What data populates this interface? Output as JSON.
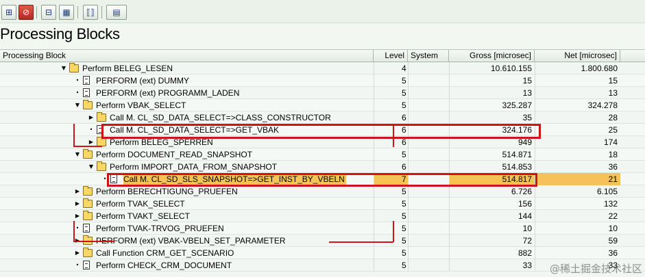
{
  "toolbar": {
    "buttons": [
      {
        "name": "hierarchy-icon",
        "glyph": "⊞"
      },
      {
        "name": "cancel-icon",
        "glyph": "⊘"
      },
      {
        "name": "expand-icon",
        "glyph": "⊟"
      },
      {
        "name": "grid-icon",
        "glyph": "▦"
      },
      {
        "name": "brackets-icon",
        "glyph": "⟦⟧"
      },
      {
        "name": "layout-icon",
        "glyph": "▤"
      }
    ]
  },
  "page": {
    "title": "Processing Blocks"
  },
  "columns": {
    "block": "Processing Block",
    "level": "Level",
    "system": "System",
    "gross": "Gross [microsec]",
    "net": "Net [microsec]"
  },
  "rows": [
    {
      "indent": 0,
      "exp": "▼",
      "icon": "folder",
      "label": "Perform BELEG_LESEN",
      "level": "4",
      "gross": "10.610.155",
      "net": "1.800.680"
    },
    {
      "indent": 1,
      "exp": "•",
      "icon": "doc",
      "label": "PERFORM (ext) DUMMY",
      "level": "5",
      "gross": "15",
      "net": "15"
    },
    {
      "indent": 1,
      "exp": "•",
      "icon": "doc",
      "label": "PERFORM (ext) PROGRAMM_LADEN",
      "level": "5",
      "gross": "13",
      "net": "13"
    },
    {
      "indent": 1,
      "exp": "▼",
      "icon": "folder",
      "label": "Perform VBAK_SELECT",
      "level": "5",
      "gross": "325.287",
      "net": "324.278"
    },
    {
      "indent": 2,
      "exp": "▶",
      "icon": "folder",
      "label": "Call M. CL_SD_DATA_SELECT=>CLASS_CONSTRUCTOR",
      "level": "6",
      "gross": "35",
      "net": "28"
    },
    {
      "indent": 2,
      "exp": "•",
      "icon": "doc",
      "label": "Call M. CL_SD_DATA_SELECT=>GET_VBAK",
      "level": "6",
      "gross": "324.176",
      "net": "25"
    },
    {
      "indent": 2,
      "exp": "▶",
      "icon": "folder",
      "label": "Perform BELEG_SPERREN",
      "level": "6",
      "gross": "949",
      "net": "174"
    },
    {
      "indent": 1,
      "exp": "▼",
      "icon": "folder",
      "label": "Perform DOCUMENT_READ_SNAPSHOT",
      "level": "5",
      "gross": "514.871",
      "net": "18"
    },
    {
      "indent": 2,
      "exp": "▼",
      "icon": "folder",
      "label": "Perform IMPORT_DATA_FROM_SNAPSHOT",
      "level": "6",
      "gross": "514.853",
      "net": "36"
    },
    {
      "indent": 3,
      "exp": "•",
      "icon": "doc",
      "label": "Call M. CL_SD_SLS_SNAPSHOT=>GET_INST_BY_VBELN",
      "level": "7",
      "gross": "514.817",
      "net": "21",
      "highlight": true
    },
    {
      "indent": 1,
      "exp": "▶",
      "icon": "folder",
      "label": "Perform BERECHTIGUNG_PRUEFEN",
      "level": "5",
      "gross": "6.726",
      "net": "6.105"
    },
    {
      "indent": 1,
      "exp": "▶",
      "icon": "folder",
      "label": "Perform TVAK_SELECT",
      "level": "5",
      "gross": "156",
      "net": "132"
    },
    {
      "indent": 1,
      "exp": "▶",
      "icon": "folder",
      "label": "Perform TVAKT_SELECT",
      "level": "5",
      "gross": "144",
      "net": "22"
    },
    {
      "indent": 1,
      "exp": "•",
      "icon": "doc",
      "label": "Perform TVAK-TRVOG_PRUEFEN",
      "level": "5",
      "gross": "10",
      "net": "10"
    },
    {
      "indent": 1,
      "exp": "▶",
      "icon": "folder",
      "label": "PERFORM (ext) VBAK-VBELN_SET_PARAMETER",
      "level": "5",
      "gross": "72",
      "net": "59"
    },
    {
      "indent": 1,
      "exp": "▶",
      "icon": "folder",
      "label": "Call Function CRM_GET_SCENARIO",
      "level": "5",
      "gross": "882",
      "net": "36"
    },
    {
      "indent": 1,
      "exp": "•",
      "icon": "doc",
      "label": "Perform CHECK_CRM_DOCUMENT",
      "level": "5",
      "gross": "33",
      "net": "33"
    }
  ],
  "watermark": "@稀土掘金技术社区"
}
